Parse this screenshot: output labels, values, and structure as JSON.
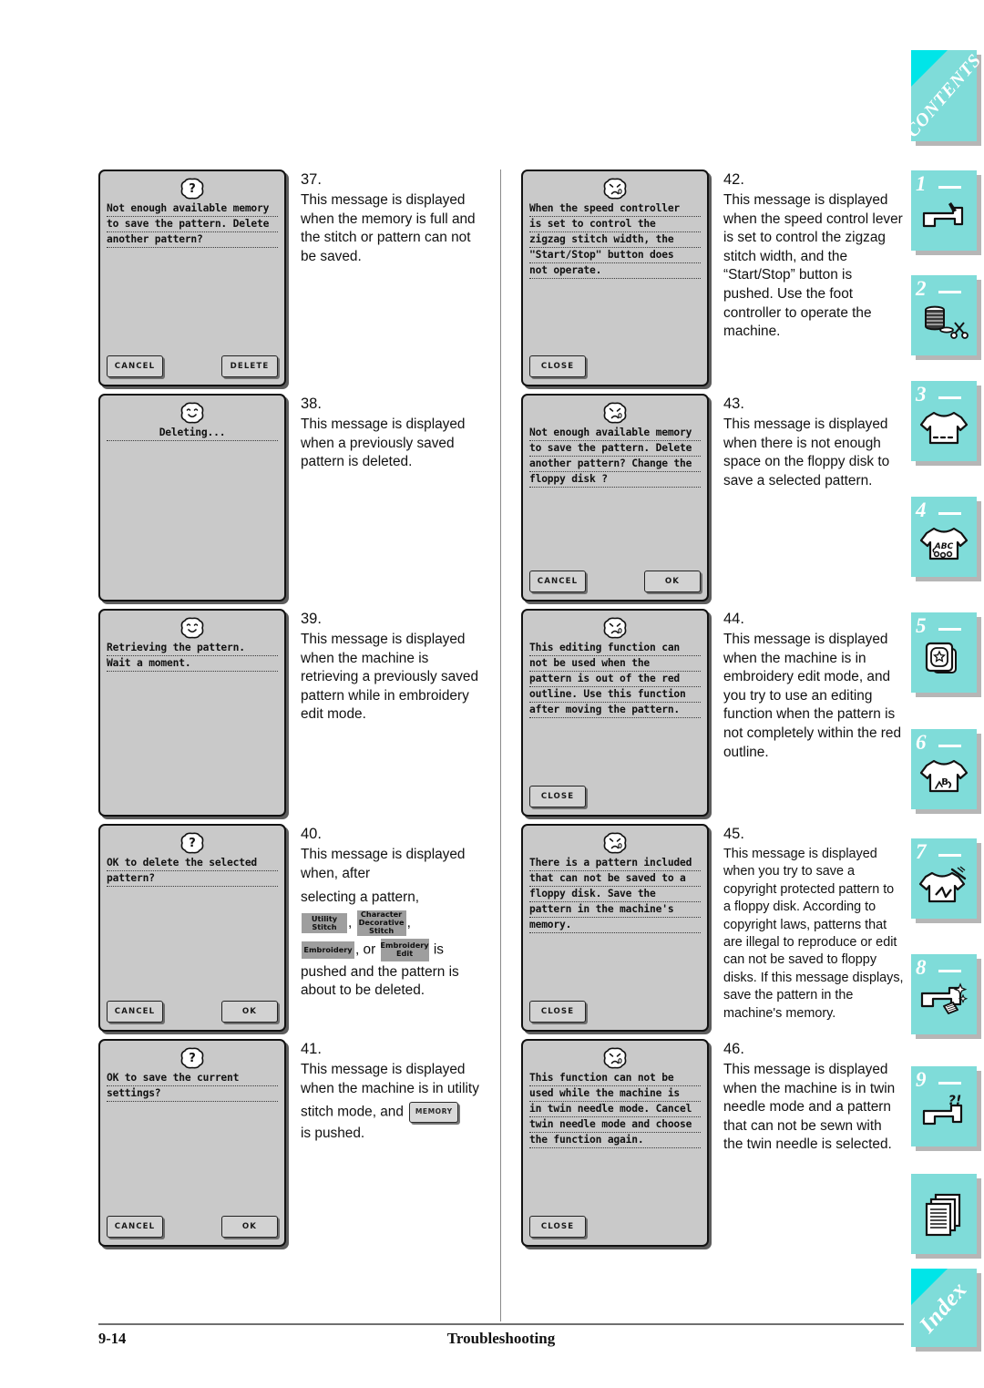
{
  "footer": {
    "page_number": "9-14",
    "section_title": "Troubleshooting"
  },
  "inline_keys": {
    "utility_stitch": "Utility\nStitch",
    "character_decorative_stitch": "Character\nDecorative\nStitch",
    "embroidery": "Embroidery",
    "embroidery_edit": "Embroidery\nEdit",
    "memory": "MEMORY"
  },
  "buttons": {
    "cancel": "CANCEL",
    "delete": "DELETE",
    "ok": "OK",
    "close": "CLOSE"
  },
  "entries": [
    {
      "number": "37.",
      "face": "question",
      "lcd_lines": [
        "Not enough available memory",
        "to save the pattern. Delete",
        "another pattern?"
      ],
      "buttons": [
        "CANCEL",
        "DELETE"
      ],
      "description": "This message is displayed when the memory is full and the stitch or pattern can not be saved."
    },
    {
      "number": "38.",
      "face": "happy",
      "lcd_lines": [
        "Deleting..."
      ],
      "centered": true,
      "buttons": [],
      "description": "This message is displayed when a previously saved pattern is deleted."
    },
    {
      "number": "39.",
      "face": "happy",
      "lcd_lines": [
        "Retrieving the pattern.",
        "Wait a moment."
      ],
      "buttons": [],
      "description": "This message is displayed when the machine is retrieving a previously saved pattern while in embroidery edit mode."
    },
    {
      "number": "40.",
      "face": "question",
      "lcd_lines": [
        "OK to delete the selected",
        "pattern?"
      ],
      "buttons": [
        "CANCEL",
        "OK"
      ],
      "description_part1": "This message is displayed when, after",
      "description_part2": "selecting a pattern,",
      "description_sep1": ",",
      "description_sep2": ",",
      "description_sep3": ", or",
      "description_part3": "is",
      "description_part4": "pushed and the pattern is about to be deleted."
    },
    {
      "number": "41.",
      "face": "question",
      "lcd_lines": [
        "OK to save the current",
        "settings?"
      ],
      "buttons": [
        "CANCEL",
        "OK"
      ],
      "description_part1": "This message is displayed when the machine is in utility",
      "description_part2": "stitch mode, and",
      "description_part3": "is pushed."
    },
    {
      "number": "42.",
      "face": "sad",
      "lcd_lines": [
        "When the speed controller",
        "is set to control the",
        "zigzag stitch width, the",
        "\"Start/Stop\" button does",
        "not operate."
      ],
      "buttons": [
        "CLOSE"
      ],
      "description": "This message is displayed when the speed control lever is set to control the zigzag stitch width, and the “Start/Stop” button is pushed. Use the foot controller to operate the machine."
    },
    {
      "number": "43.",
      "face": "sad",
      "lcd_lines": [
        "Not enough available memory",
        "to save the pattern. Delete",
        "another pattern? Change the",
        "floppy disk ?"
      ],
      "buttons": [
        "CANCEL",
        "OK"
      ],
      "description": "This message is displayed when there is not enough space on the floppy disk to save a selected pattern."
    },
    {
      "number": "44.",
      "face": "sad",
      "lcd_lines": [
        "This editing function can",
        "not be used when the",
        "pattern is out of the red",
        "outline. Use this function",
        "after moving the pattern."
      ],
      "buttons": [
        "CLOSE"
      ],
      "description": "This message is displayed when the machine is in embroidery edit mode, and you try to use an editing function when the pattern is not completely within the red outline."
    },
    {
      "number": "45.",
      "face": "sad",
      "lcd_lines": [
        "There is a pattern included",
        "that can not be saved to a",
        "floppy disk. Save the",
        "pattern in the machine's",
        "memory."
      ],
      "buttons": [
        "CLOSE"
      ],
      "description": "This message is displayed when you try to save a copyright protected pattern to a floppy disk. According to copyright laws, patterns that are illegal to reproduce or edit can not be saved to floppy disks. If this message displays, save the pattern in the machine's memory."
    },
    {
      "number": "46.",
      "face": "sad",
      "lcd_lines": [
        "This function can not be",
        "used while the machine is",
        "in twin needle mode. Cancel",
        "twin needle mode and choose",
        "the function again."
      ],
      "buttons": [
        "CLOSE"
      ],
      "description": "This message is displayed when the machine is in twin needle mode and a pattern that can not be sewn with the twin needle is selected."
    }
  ],
  "tab_rail": {
    "accent_color": "#7fdcd9",
    "fold_color": "#00e5e8",
    "tabs": [
      {
        "label": "CONTENTS",
        "kind": "corner",
        "icon": ""
      },
      {
        "label": "1",
        "kind": "numbered",
        "icon": "sewing-machine-icon"
      },
      {
        "label": "2",
        "kind": "numbered",
        "icon": "thread-spool-scissors-icon"
      },
      {
        "label": "3",
        "kind": "numbered",
        "icon": "shirt-stitch-icon"
      },
      {
        "label": "4",
        "kind": "numbered",
        "icon": "shirt-abc-icon"
      },
      {
        "label": "5",
        "kind": "numbered",
        "icon": "embroidery-card-star-icon"
      },
      {
        "label": "6",
        "kind": "numbered",
        "icon": "shirt-letter-b-icon"
      },
      {
        "label": "7",
        "kind": "numbered",
        "icon": "shirt-needle-icon"
      },
      {
        "label": "8",
        "kind": "numbered",
        "icon": "machine-sparkle-icon"
      },
      {
        "label": "9",
        "kind": "numbered",
        "icon": "machine-question-icon"
      },
      {
        "label": "",
        "kind": "plain",
        "icon": "documents-icon"
      },
      {
        "label": "Index",
        "kind": "corner",
        "icon": ""
      }
    ]
  }
}
